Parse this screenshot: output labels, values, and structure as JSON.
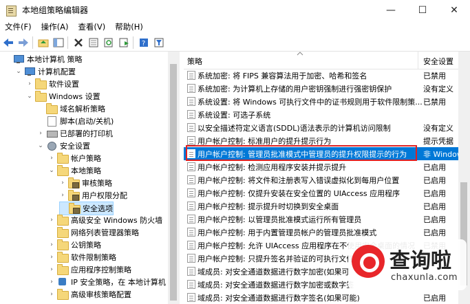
{
  "window": {
    "title": "本地组策略编辑器",
    "min": "—",
    "max": "☐",
    "close": "✕"
  },
  "menu": [
    "文件(F)",
    "操作(A)",
    "查看(V)",
    "帮助(H)"
  ],
  "tree": [
    {
      "label": "本地计算机 策略",
      "indent": 0,
      "exp": "",
      "icon": "computer-icon"
    },
    {
      "label": "计算机配置",
      "indent": 1,
      "exp": "⌄",
      "icon": "computer-icon"
    },
    {
      "label": "软件设置",
      "indent": 2,
      "exp": "›",
      "icon": "folder-icon"
    },
    {
      "label": "Windows 设置",
      "indent": 2,
      "exp": "⌄",
      "icon": "folder-icon"
    },
    {
      "label": "域名解析策略",
      "indent": 3,
      "exp": "",
      "icon": "folder-icon"
    },
    {
      "label": "脚本(启动/关机)",
      "indent": 3,
      "exp": "",
      "icon": "document-icon"
    },
    {
      "label": "已部署的打印机",
      "indent": 3,
      "exp": "›",
      "icon": "printer-icon"
    },
    {
      "label": "安全设置",
      "indent": 3,
      "exp": "⌄",
      "icon": "gear-icon"
    },
    {
      "label": "帐户策略",
      "indent": 4,
      "exp": "›",
      "icon": "folder-icon"
    },
    {
      "label": "本地策略",
      "indent": 4,
      "exp": "⌄",
      "icon": "folder-icon"
    },
    {
      "label": "审核策略",
      "indent": 5,
      "exp": "›",
      "icon": "lock-folder-icon"
    },
    {
      "label": "用户权限分配",
      "indent": 5,
      "exp": "›",
      "icon": "lock-folder-icon"
    },
    {
      "label": "安全选项",
      "indent": 5,
      "exp": "",
      "icon": "lock-folder-icon",
      "selected": true
    },
    {
      "label": "高级安全 Windows 防火墙",
      "indent": 4,
      "exp": "›",
      "icon": "folder-icon"
    },
    {
      "label": "网络列表管理器策略",
      "indent": 4,
      "exp": "",
      "icon": "folder-icon"
    },
    {
      "label": "公钥策略",
      "indent": 4,
      "exp": "›",
      "icon": "folder-icon"
    },
    {
      "label": "软件限制策略",
      "indent": 4,
      "exp": "›",
      "icon": "folder-icon"
    },
    {
      "label": "应用程序控制策略",
      "indent": 4,
      "exp": "›",
      "icon": "folder-icon"
    },
    {
      "label": "IP 安全策略，在 本地计算机",
      "indent": 4,
      "exp": "›",
      "icon": "network-icon"
    },
    {
      "label": "高级审核策略配置",
      "indent": 4,
      "exp": "›",
      "icon": "folder-icon"
    }
  ],
  "list": {
    "columns": [
      "策略",
      "安全设置"
    ],
    "rows": [
      {
        "policy": "系统加密: 将 FIPS 兼容算法用于加密、哈希和签名",
        "setting": "已禁用"
      },
      {
        "policy": "系统加密: 为计算机上存储的用户密钥强制进行强密钥保护",
        "setting": "没有定义"
      },
      {
        "policy": "系统设置: 将 Windows 可执行文件中的证书规则用于软件限制策...",
        "setting": "已禁用"
      },
      {
        "policy": "系统设置: 可选子系统",
        "setting": ""
      },
      {
        "policy": "以安全描述符定义语言(SDDL)语法表示的计算机访问限制",
        "setting": "没有定义"
      },
      {
        "policy": "用户帐户控制: 标准用户的提升提示行为",
        "setting": "提示凭据"
      },
      {
        "policy": "用户帐户控制: 管理员批准模式中管理员的提升权限提示的行为",
        "setting": "非 Window",
        "selected": true
      },
      {
        "policy": "用户帐户控制: 检测应用程序安装并提示提升",
        "setting": "已启用"
      },
      {
        "policy": "用户帐户控制: 将文件和注册表写入错误虚拟化到每用户位置",
        "setting": "已启用"
      },
      {
        "policy": "用户帐户控制: 仅提升安装在安全位置的 UIAccess 应用程序",
        "setting": "已启用"
      },
      {
        "policy": "用户帐户控制: 提示提升时切换到安全桌面",
        "setting": "已启用"
      },
      {
        "policy": "用户帐户控制: 以管理员批准模式运行所有管理员",
        "setting": "已启用"
      },
      {
        "policy": "用户帐户控制: 用于内置管理员帐户的管理员批准模式",
        "setting": "已启用"
      },
      {
        "policy": "用户帐户控制: 允许 UIAccess 应用程序在不使用安全桌面的情况",
        "setting": "已禁用"
      },
      {
        "policy": "用户帐户控制: 只提升签名并验证的可执行文件",
        "setting": ""
      },
      {
        "policy": "域成员: 对安全通道数据进行数字加密(如果可",
        "setting": ""
      },
      {
        "policy": "域成员: 对安全通道数据进行数字加密或数字签",
        "setting": ""
      },
      {
        "policy": "域成员: 对安全通道数据进行数字签名(如果可能)",
        "setting": "已启用"
      }
    ]
  },
  "watermark": {
    "text": "查询啦",
    "sub": "chaxunla.com"
  }
}
